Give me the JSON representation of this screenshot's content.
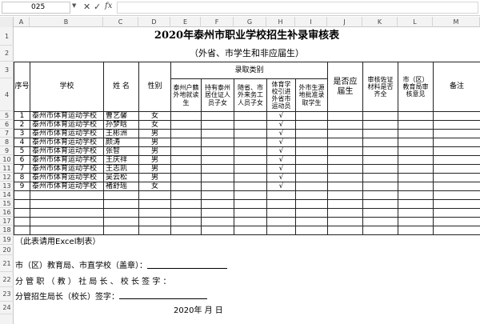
{
  "formula_bar": {
    "name_box": "025",
    "cancel_glyph": "✕",
    "confirm_glyph": "✓",
    "fx_label": "fx",
    "formula_value": ""
  },
  "sheet": {
    "columns": [
      "A",
      "B",
      "C",
      "D",
      "E",
      "F",
      "G",
      "H",
      "I",
      "J",
      "K",
      "L",
      "M"
    ],
    "rows": [
      "1",
      "2",
      "3",
      "4",
      "5",
      "6",
      "7",
      "8",
      "9",
      "10",
      "11",
      "12",
      "13",
      "14",
      "15",
      "16",
      "17",
      "18",
      "19",
      "20",
      "21",
      "22",
      "23",
      "24"
    ]
  },
  "document": {
    "title": "2020年泰州市职业学校招生补录审核表",
    "subtitle": "（外省、市学生和非应届生）",
    "headers": {
      "seq": "序号",
      "school": "学校",
      "name": "姓 名",
      "gender": "性别",
      "category_group": "录取类别",
      "cat1": "泰州户籍外地就读生",
      "cat2": "持有泰州居住证人员子女",
      "cat3": "随省、市外来务工人员子女",
      "cat4": "体育学校引进外省市运动员",
      "cat5": "外市生源地批准录取学生",
      "fresh_grad": "是否应届生",
      "material": "审核佐证材料是否齐全",
      "bureau": "市（区）教育局审核意见",
      "remark": "备注"
    },
    "records": [
      {
        "seq": "1",
        "school": "泰州市体育运动学校",
        "name": "曹艺馨",
        "gender": "女",
        "mark": "√"
      },
      {
        "seq": "2",
        "school": "泰州市体育运动学校",
        "name": "孙梦晗",
        "gender": "女",
        "mark": "√"
      },
      {
        "seq": "3",
        "school": "泰州市体育运动学校",
        "name": "王彬洲",
        "gender": "男",
        "mark": "√"
      },
      {
        "seq": "4",
        "school": "泰州市体育运动学校",
        "name": "颜涛",
        "gender": "男",
        "mark": "√"
      },
      {
        "seq": "5",
        "school": "泰州市体育运动学校",
        "name": "张智",
        "gender": "男",
        "mark": "√"
      },
      {
        "seq": "6",
        "school": "泰州市体育运动学校",
        "name": "王庆祥",
        "gender": "男",
        "mark": "√"
      },
      {
        "seq": "7",
        "school": "泰州市体育运动学校",
        "name": "王志凯",
        "gender": "男",
        "mark": "√"
      },
      {
        "seq": "8",
        "school": "泰州市体育运动学校",
        "name": "吴云松",
        "gender": "男",
        "mark": "√"
      },
      {
        "seq": "9",
        "school": "泰州市体育运动学校",
        "name": "褚舒瑶",
        "gender": "女",
        "mark": "√"
      }
    ],
    "note": "（此表请用Excel制表）",
    "sign_bureau": "市（区）教育局、市直学校（盖章）：",
    "sign_principal": "分 管 职 （ 教 ） 社 局 长 、 校 长 签 字 ：",
    "sign_recruit": "分管招生局长（校长）签字：",
    "date_line": "2020年    月    日"
  }
}
